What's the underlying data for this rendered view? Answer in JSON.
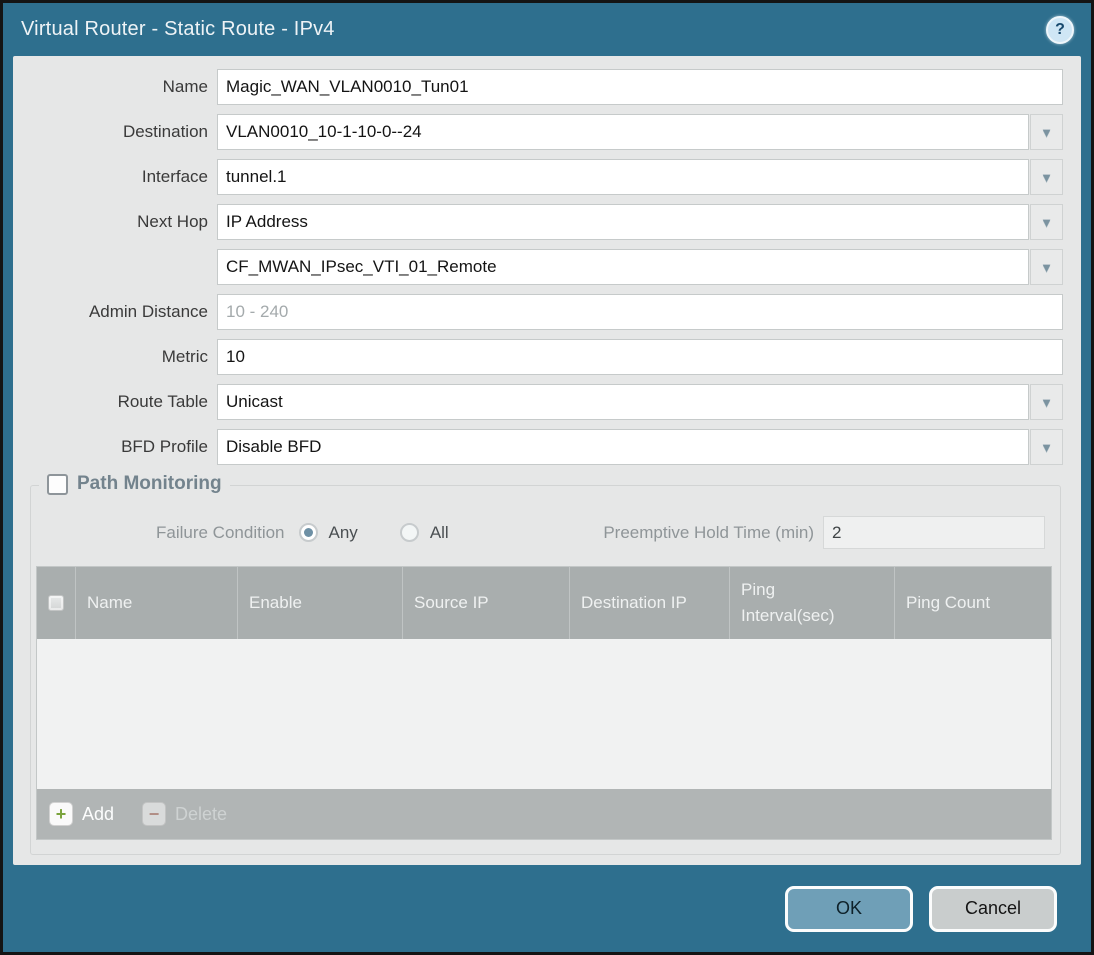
{
  "title_bar": {
    "title": "Virtual Router - Static Route - IPv4"
  },
  "icons": {
    "help_glyph": "?",
    "dropdown_glyph": "▼",
    "add_glyph": "+",
    "delete_glyph": "−"
  },
  "form": {
    "name": {
      "label": "Name",
      "value": "Magic_WAN_VLAN0010_Tun01"
    },
    "destination": {
      "label": "Destination",
      "value": "VLAN0010_10-1-10-0--24"
    },
    "interface": {
      "label": "Interface",
      "value": "tunnel.1"
    },
    "next_hop": {
      "label": "Next Hop",
      "value": "IP Address"
    },
    "next_hop_address": {
      "value": "CF_MWAN_IPsec_VTI_01_Remote"
    },
    "admin_distance": {
      "label": "Admin Distance",
      "placeholder": "10 - 240",
      "value": ""
    },
    "metric": {
      "label": "Metric",
      "value": "10"
    },
    "route_table": {
      "label": "Route Table",
      "value": "Unicast"
    },
    "bfd_profile": {
      "label": "BFD Profile",
      "value": "Disable BFD"
    }
  },
  "path_monitoring": {
    "legend": "Path Monitoring",
    "checked": false,
    "failure_condition": {
      "label": "Failure Condition",
      "options": [
        {
          "label": "Any",
          "selected": true
        },
        {
          "label": "All",
          "selected": false
        }
      ]
    },
    "preemptive_hold_time": {
      "label": "Preemptive Hold Time (min)",
      "value": "2"
    },
    "table": {
      "columns": [
        "Name",
        "Enable",
        "Source IP",
        "Destination IP",
        "Ping Interval(sec)",
        "Ping Count"
      ],
      "rows": []
    },
    "toolbar": {
      "add_label": "Add",
      "delete_label": "Delete",
      "delete_enabled": false
    }
  },
  "footer": {
    "ok_label": "OK",
    "cancel_label": "Cancel"
  },
  "colors": {
    "titlebar_teal": "#2e6f8e",
    "panel_grey": "#e6e7e7",
    "table_header_grey": "#a9aeae",
    "ok_button_blue": "#6f9fb7",
    "add_green": "#7aa33c",
    "delete_red": "#b2705f",
    "selected_radio": "#6e90a5"
  }
}
